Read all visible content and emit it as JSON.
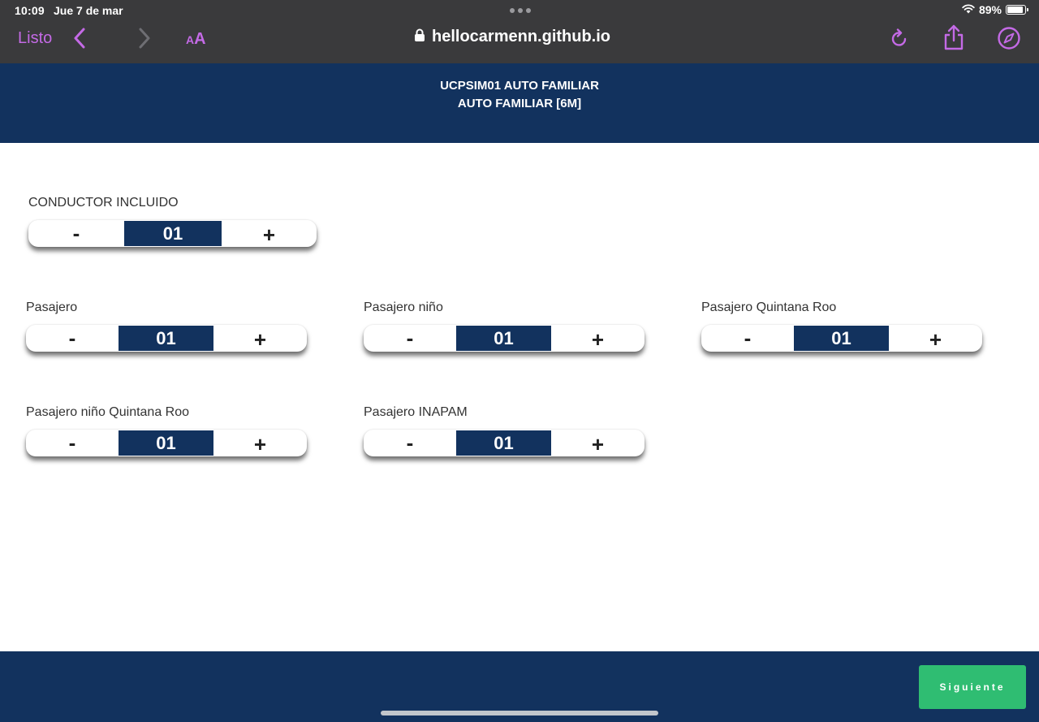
{
  "status_bar": {
    "time": "10:09",
    "date": "Jue 7 de mar",
    "battery": "89%",
    "battery_level": 0.89
  },
  "browser": {
    "done_label": "Listo",
    "url": "hellocarmenn.github.io",
    "text_size_small": "A",
    "text_size_big": "A",
    "accent_color": "#c46ae6"
  },
  "header": {
    "title": "UCPSIM01 AUTO FAMILIAR",
    "subtitle": "AUTO FAMILIAR [6M]"
  },
  "counters": [
    {
      "label": "CONDUCTOR INCLUIDO",
      "value": "01",
      "minus": "-",
      "plus": "+"
    },
    {
      "label": "Pasajero",
      "value": "01",
      "minus": "-",
      "plus": "+"
    },
    {
      "label": "Pasajero niño",
      "value": "01",
      "minus": "-",
      "plus": "+"
    },
    {
      "label": "Pasajero Quintana Roo",
      "value": "01",
      "minus": "-",
      "plus": "+"
    },
    {
      "label": "Pasajero niño Quintana Roo",
      "value": "01",
      "minus": "-",
      "plus": "+"
    },
    {
      "label": "Pasajero INAPAM",
      "value": "01",
      "minus": "-",
      "plus": "+"
    }
  ],
  "footer": {
    "next_label": "Siguiente"
  },
  "colors": {
    "primary": "#12325e",
    "success": "#2fbd72"
  }
}
